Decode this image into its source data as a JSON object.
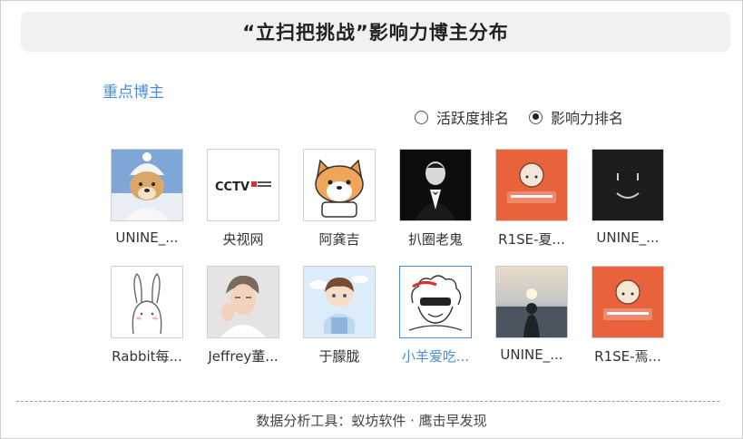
{
  "header": {
    "title": "“立扫把挑战”影响力博主分布"
  },
  "section": {
    "label": "重点博主"
  },
  "ranking": {
    "options": [
      {
        "label": "活跃度排名",
        "selected": false
      },
      {
        "label": "影响力排名",
        "selected": true
      }
    ]
  },
  "bloggers": [
    {
      "name": "UNINE_...",
      "icon": "snow-dog-avatar"
    },
    {
      "name": "央视网",
      "icon": "cctv-logo-avatar"
    },
    {
      "name": "阿龚吉",
      "icon": "corgi-cartoon-avatar"
    },
    {
      "name": "扒圈老鬼",
      "icon": "godfather-avatar"
    },
    {
      "name": "R1SE-夏...",
      "icon": "orange-cartoon-avatar"
    },
    {
      "name": "UNINE_...",
      "icon": "smiley-black-avatar"
    },
    {
      "name": "Rabbit每...",
      "icon": "rabbit-sketch-avatar"
    },
    {
      "name": "Jeffrey董...",
      "icon": "person-photo-avatar"
    },
    {
      "name": "于朦胧",
      "icon": "anime-boy-avatar"
    },
    {
      "name": "小羊爱吃...",
      "icon": "sheep-sketch-avatar"
    },
    {
      "name": "UNINE_...",
      "icon": "sunset-silhouette-avatar"
    },
    {
      "name": "R1SE-焉...",
      "icon": "orange-cartoon-avatar"
    }
  ],
  "footer": {
    "text": "数据分析工具：蚁坊软件 · 鹰击早发现"
  },
  "colors": {
    "accent": "#4a8fd6",
    "title_bg": "#f1f1f1",
    "avatar_orange": "#e8623c"
  }
}
